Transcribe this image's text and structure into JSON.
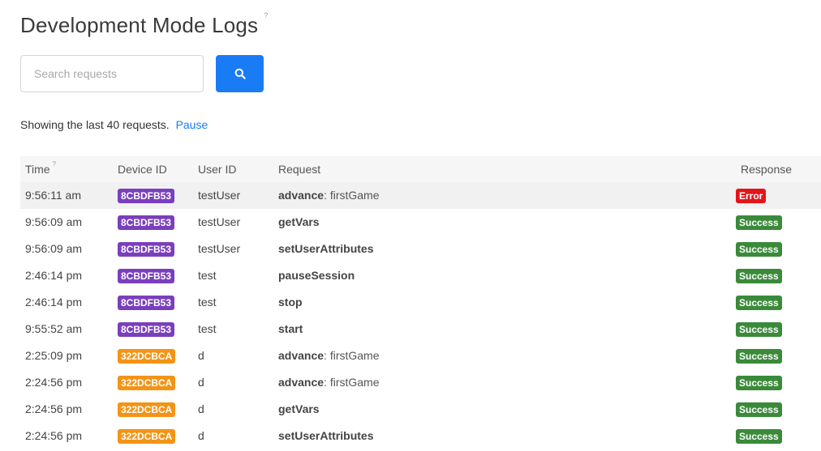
{
  "page": {
    "title": "Development Mode Logs",
    "help": "?"
  },
  "search": {
    "placeholder": "Search requests",
    "value": ""
  },
  "status": {
    "text": "Showing the last 40 requests.",
    "pause_label": "Pause"
  },
  "colors": {
    "accent": "#1a7cf5",
    "success": "#3a8a3a",
    "error": "#e4141b",
    "device_purple": "#7a3fbc",
    "device_orange": "#f39416"
  },
  "table": {
    "headers": {
      "time": "Time",
      "time_help": "?",
      "device": "Device ID",
      "user": "User ID",
      "request": "Request",
      "response": "Response"
    },
    "rows": [
      {
        "time": "9:56:11 am",
        "device": "8CBDFB53",
        "device_color": "#7a3fbc",
        "user": "testUser",
        "method": "advance",
        "arg": "firstGame",
        "response": "Error",
        "response_color": "#e4141b"
      },
      {
        "time": "9:56:09 am",
        "device": "8CBDFB53",
        "device_color": "#7a3fbc",
        "user": "testUser",
        "method": "getVars",
        "arg": "",
        "response": "Success",
        "response_color": "#3a8a3a"
      },
      {
        "time": "9:56:09 am",
        "device": "8CBDFB53",
        "device_color": "#7a3fbc",
        "user": "testUser",
        "method": "setUserAttributes",
        "arg": "",
        "response": "Success",
        "response_color": "#3a8a3a"
      },
      {
        "time": "2:46:14 pm",
        "device": "8CBDFB53",
        "device_color": "#7a3fbc",
        "user": "test",
        "method": "pauseSession",
        "arg": "",
        "response": "Success",
        "response_color": "#3a8a3a"
      },
      {
        "time": "2:46:14 pm",
        "device": "8CBDFB53",
        "device_color": "#7a3fbc",
        "user": "test",
        "method": "stop",
        "arg": "",
        "response": "Success",
        "response_color": "#3a8a3a"
      },
      {
        "time": "9:55:52 am",
        "device": "8CBDFB53",
        "device_color": "#7a3fbc",
        "user": "test",
        "method": "start",
        "arg": "",
        "response": "Success",
        "response_color": "#3a8a3a"
      },
      {
        "time": "2:25:09 pm",
        "device": "322DCBCA",
        "device_color": "#f39416",
        "user": "d",
        "method": "advance",
        "arg": "firstGame",
        "response": "Success",
        "response_color": "#3a8a3a"
      },
      {
        "time": "2:24:56 pm",
        "device": "322DCBCA",
        "device_color": "#f39416",
        "user": "d",
        "method": "advance",
        "arg": "firstGame",
        "response": "Success",
        "response_color": "#3a8a3a"
      },
      {
        "time": "2:24:56 pm",
        "device": "322DCBCA",
        "device_color": "#f39416",
        "user": "d",
        "method": "getVars",
        "arg": "",
        "response": "Success",
        "response_color": "#3a8a3a"
      },
      {
        "time": "2:24:56 pm",
        "device": "322DCBCA",
        "device_color": "#f39416",
        "user": "d",
        "method": "setUserAttributes",
        "arg": "",
        "response": "Success",
        "response_color": "#3a8a3a"
      }
    ]
  }
}
